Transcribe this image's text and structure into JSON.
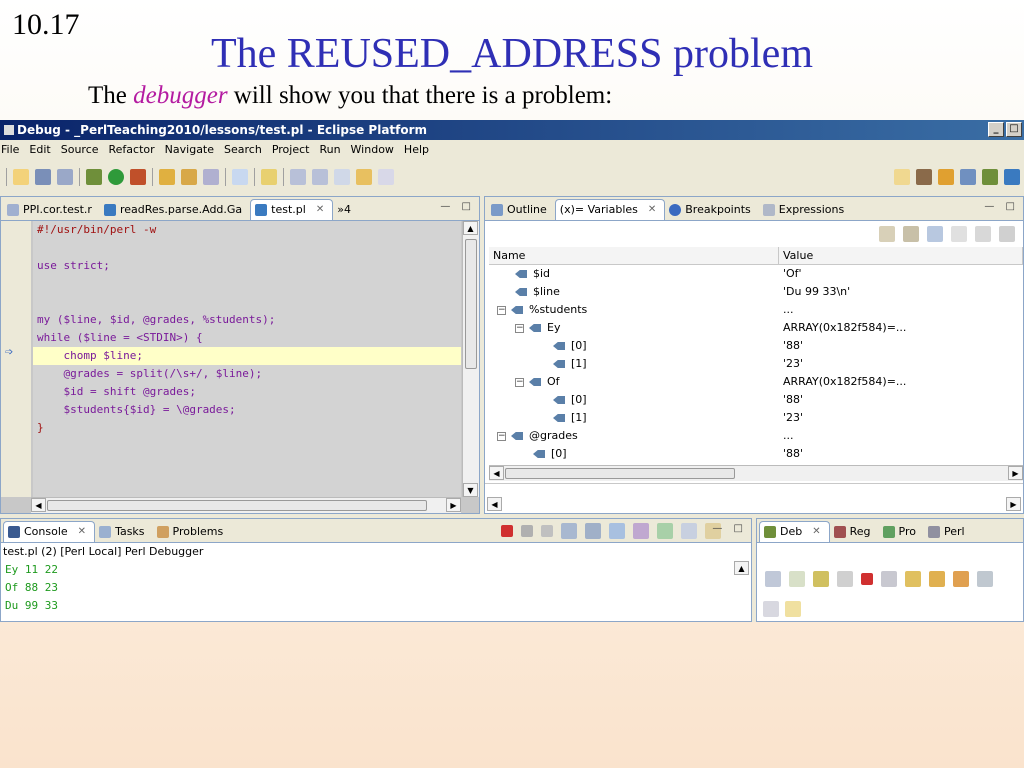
{
  "slide": {
    "number": "10.17",
    "title": "The REUSED_ADDRESS problem",
    "subtitle_pre": "The ",
    "subtitle_em": "debugger",
    "subtitle_post": " will show you that there is a problem:"
  },
  "window": {
    "title": "Debug - _PerlTeaching2010/lessons/test.pl - Eclipse Platform"
  },
  "menu": [
    "File",
    "Edit",
    "Source",
    "Refactor",
    "Navigate",
    "Search",
    "Project",
    "Run",
    "Window",
    "Help"
  ],
  "editor": {
    "tabs": [
      {
        "label": "PPI.cor.test.r"
      },
      {
        "label": "readRes.parse.Add.Ga"
      },
      {
        "label": "test.pl"
      },
      {
        "label": "»4"
      }
    ],
    "code": [
      "#!/usr/bin/perl -w",
      "",
      "use strict;",
      "",
      "",
      "my ($line, $id, @grades, %students);",
      "while ($line = <STDIN>) {",
      "    chomp $line;",
      "    @grades = split(/\\s+/, $line);",
      "    $id = shift @grades;",
      "    $students{$id} = \\@grades;",
      "}"
    ]
  },
  "variables_view": {
    "tabs": [
      {
        "label": "Outline"
      },
      {
        "label": "(x)= Variables"
      },
      {
        "label": "Breakpoints"
      },
      {
        "label": "Expressions"
      }
    ],
    "columns": {
      "name": "Name",
      "value": "Value"
    },
    "rows": [
      {
        "name": "$id",
        "value": "'Of'"
      },
      {
        "name": "$line",
        "value": "'Du 99 33\\n'"
      },
      {
        "name": "%students",
        "value": "..."
      },
      {
        "name": "Ey",
        "value": "ARRAY(0x182f584)=..."
      },
      {
        "name": "[0]",
        "value": "'88'"
      },
      {
        "name": "[1]",
        "value": "'23'"
      },
      {
        "name": "Of",
        "value": "ARRAY(0x182f584)=..."
      },
      {
        "name": "[0]",
        "value": "'88'"
      },
      {
        "name": "[1]",
        "value": "'23'"
      },
      {
        "name": "@grades",
        "value": "..."
      },
      {
        "name": "[0]",
        "value": "'88'"
      }
    ],
    "expanders": [
      "",
      "",
      "−",
      "−",
      "",
      "",
      "−",
      "",
      "",
      "−",
      ""
    ]
  },
  "console": {
    "tabs": [
      {
        "label": "Console"
      },
      {
        "label": "Tasks"
      },
      {
        "label": "Problems"
      }
    ],
    "process_label": "test.pl (2) [Perl Local] Perl Debugger",
    "lines": [
      "Ey 11 22",
      "Of 88 23",
      "Du 99 33"
    ]
  },
  "debug_view": {
    "tabs": [
      {
        "label": "Deb"
      },
      {
        "label": "Reg"
      },
      {
        "label": "Pro"
      },
      {
        "label": "Perl"
      }
    ]
  },
  "colors": {
    "title": "#2f2fb5",
    "emphasis": "#b41ba1",
    "console_text": "#1e9a1e",
    "current_line": "#ffffc8"
  }
}
